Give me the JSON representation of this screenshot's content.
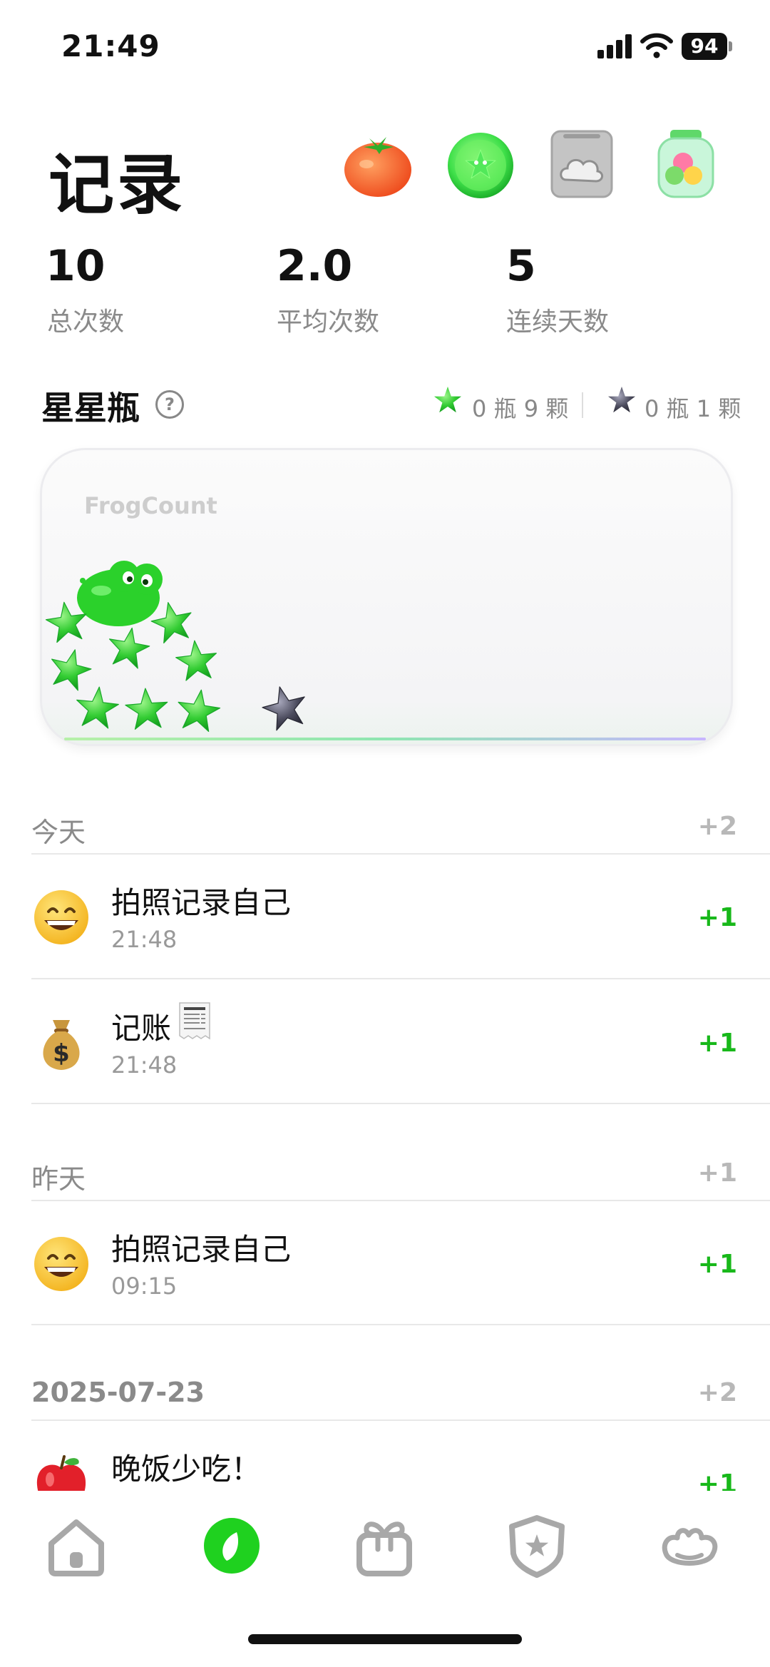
{
  "status_bar": {
    "time": "21:49",
    "battery": "94"
  },
  "header": {
    "title": "记录",
    "icons": [
      "tomato-icon",
      "green-star-ball-icon",
      "cloud-card-icon",
      "candy-jar-icon"
    ]
  },
  "stats": [
    {
      "value": "10",
      "label": "总次数"
    },
    {
      "value": "2.0",
      "label": "平均次数"
    },
    {
      "value": "5",
      "label": "连续天数"
    }
  ],
  "star_jar": {
    "title": "星星瓶",
    "help": "?",
    "green_count": "0 瓶 9 颗",
    "dark_count": "0 瓶 1 颗",
    "brand": "FrogCount",
    "green_stars": 9,
    "dark_stars": 1
  },
  "days": [
    {
      "label": "今天",
      "total": "+2",
      "entries": [
        {
          "icon": "grinning-face-icon",
          "title": "拍照记录自己",
          "time": "21:48",
          "plus": "+1"
        },
        {
          "icon": "money-bag-icon",
          "title": "记账",
          "time": "21:48",
          "plus": "+1"
        }
      ]
    },
    {
      "label": "昨天",
      "total": "+1",
      "entries": [
        {
          "icon": "grinning-face-icon",
          "title": "拍照记录自己",
          "time": "09:15",
          "plus": "+1"
        }
      ]
    },
    {
      "label": "2025-07-23",
      "total": "+2",
      "entries": [
        {
          "icon": "apple-icon",
          "title": "晚饭少吃！",
          "time": "",
          "plus": "+1"
        }
      ]
    }
  ],
  "tabbar": {
    "tabs": [
      "home-tab",
      "record-tab",
      "gift-tab",
      "star-badge-tab",
      "frog-tab"
    ],
    "active": "record-tab",
    "accent": "#1fd11f"
  },
  "colors": {
    "plus_green": "#18b81a",
    "muted": "#8a8a8a"
  }
}
